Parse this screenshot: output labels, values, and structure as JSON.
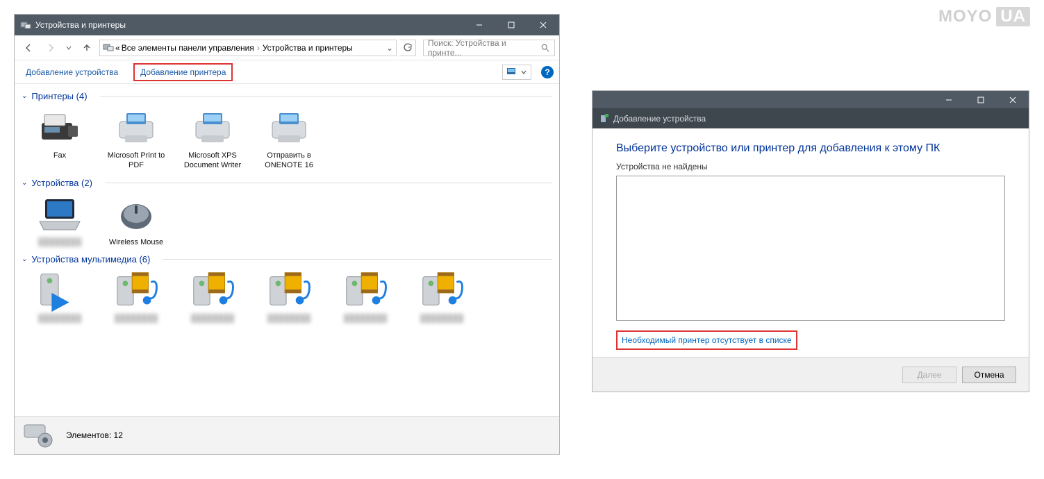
{
  "logo": {
    "brand": "MOYO",
    "suffix": "UA"
  },
  "win1": {
    "title": "Устройства и принтеры",
    "breadcrumb": {
      "prefix": "«",
      "seg1": "Все элементы панели управления",
      "seg2": "Устройства и принтеры"
    },
    "search_placeholder": "Поиск: Устройства и принте...",
    "toolbar": {
      "add_device": "Добавление устройства",
      "add_printer": "Добавление принтера"
    },
    "groups": {
      "printers": {
        "header": "Принтеры (4)",
        "items": [
          {
            "label": "Fax",
            "icon": "fax"
          },
          {
            "label": "Microsoft Print to PDF",
            "icon": "printer"
          },
          {
            "label": "Microsoft XPS Document Writer",
            "icon": "printer"
          },
          {
            "label": "Отправить в ONENOTE 16",
            "icon": "printer"
          }
        ]
      },
      "devices": {
        "header": "Устройства (2)",
        "items": [
          {
            "label": "",
            "icon": "laptop",
            "blurred": true
          },
          {
            "label": "Wireless Mouse",
            "icon": "mouse"
          }
        ]
      },
      "multimedia": {
        "header": "Устройства мультимедиа (6)",
        "items": [
          {
            "label": "",
            "icon": "mediasvr-play",
            "blurred": true
          },
          {
            "label": "",
            "icon": "mediasvr",
            "blurred": true
          },
          {
            "label": "",
            "icon": "mediasvr",
            "blurred": true
          },
          {
            "label": "",
            "icon": "mediasvr",
            "blurred": true
          },
          {
            "label": "",
            "icon": "mediasvr",
            "blurred": true
          },
          {
            "label": "",
            "icon": "mediasvr",
            "blurred": true
          }
        ]
      }
    },
    "statusbar": {
      "text": "Элементов: 12"
    }
  },
  "win2": {
    "subtitle": "Добавление устройства",
    "heading": "Выберите устройство или принтер для добавления к этому ПК",
    "note": "Устройства не найдены",
    "link": "Необходимый принтер отсутствует в списке",
    "next": "Далее",
    "cancel": "Отмена"
  }
}
